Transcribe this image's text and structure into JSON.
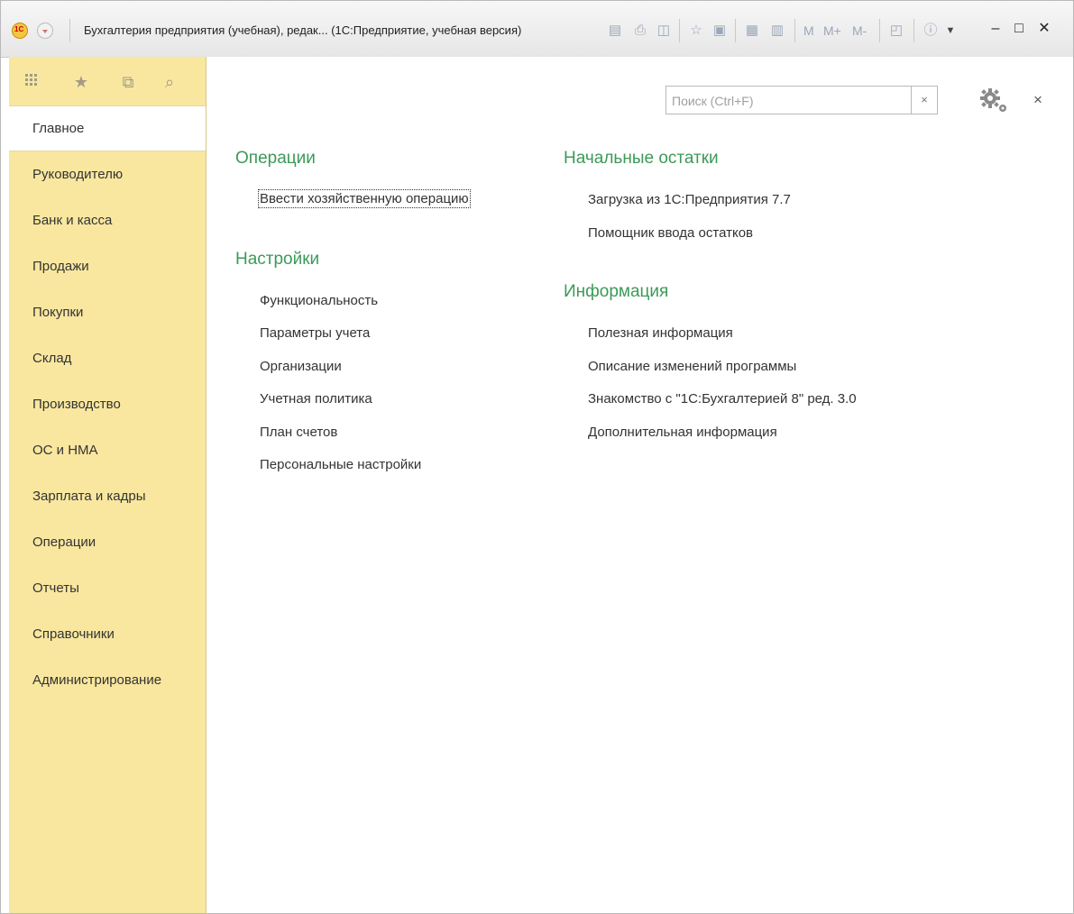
{
  "window": {
    "title": "Бухгалтерия предприятия (учебная), редак...  (1С:Предприятие, учебная версия)",
    "toolbar_text_m": "M",
    "toolbar_text_mplus": "M+",
    "toolbar_text_mminus": "M-"
  },
  "sidebar": {
    "items": [
      {
        "label": "Главное"
      },
      {
        "label": "Руководителю"
      },
      {
        "label": "Банк и касса"
      },
      {
        "label": "Продажи"
      },
      {
        "label": "Покупки"
      },
      {
        "label": "Склад"
      },
      {
        "label": "Производство"
      },
      {
        "label": "ОС и НМА"
      },
      {
        "label": "Зарплата и кадры"
      },
      {
        "label": "Операции"
      },
      {
        "label": "Отчеты"
      },
      {
        "label": "Справочники"
      },
      {
        "label": "Администрирование"
      }
    ]
  },
  "search": {
    "placeholder": "Поиск (Ctrl+F)",
    "value": "",
    "clear_label": "×"
  },
  "main": {
    "close_label": "×",
    "operations": {
      "title": "Операции",
      "links": [
        {
          "label": "Ввести хозяйственную операцию"
        }
      ]
    },
    "settings": {
      "title": "Настройки",
      "links": [
        {
          "label": "Функциональность"
        },
        {
          "label": "Параметры учета"
        },
        {
          "label": "Организации"
        },
        {
          "label": "Учетная политика"
        },
        {
          "label": "План счетов"
        },
        {
          "label": "Персональные настройки"
        }
      ]
    },
    "opening_balances": {
      "title": "Начальные остатки",
      "links": [
        {
          "label": "Загрузка из 1С:Предприятия 7.7"
        },
        {
          "label": "Помощник ввода остатков"
        }
      ]
    },
    "information": {
      "title": "Информация",
      "links": [
        {
          "label": "Полезная информация"
        },
        {
          "label": "Описание изменений программы"
        },
        {
          "label": "Знакомство с \"1С:Бухгалтерией 8\" ред. 3.0"
        },
        {
          "label": "Дополнительная информация"
        }
      ]
    }
  },
  "colors": {
    "sidebar_bg": "#f9e79f",
    "section_title": "#3c9a57",
    "text": "#333333"
  }
}
